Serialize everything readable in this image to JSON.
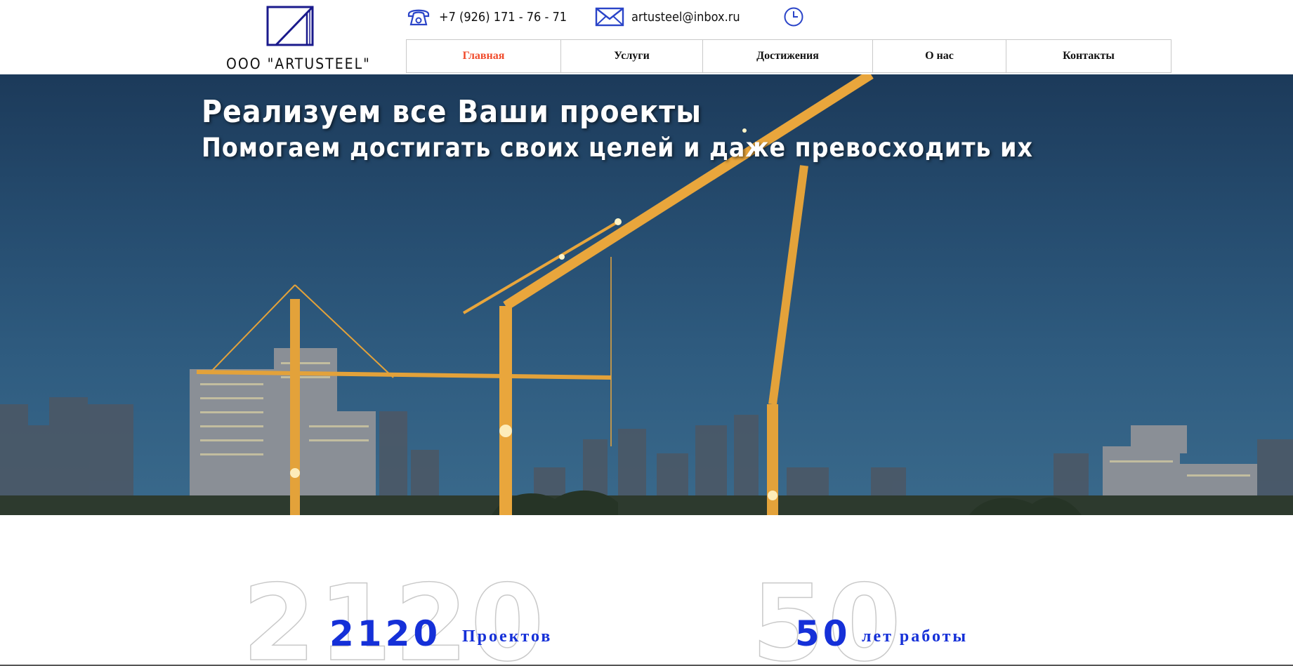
{
  "brand": {
    "name": "ООО \"ARTUSTEEL\"",
    "logo_icon": "logo-mark-icon",
    "color": "#1a1a8c"
  },
  "contacts": {
    "phone": {
      "icon": "phone-icon",
      "text": "+7 (926) 171 - 76 - 71"
    },
    "email": {
      "icon": "mail-icon",
      "text": "artusteel@inbox.ru"
    },
    "hours": {
      "icon": "clock-icon"
    },
    "icon_color": "#2a44c8"
  },
  "nav": {
    "items": [
      {
        "label": "Главная",
        "active": true
      },
      {
        "label": "Услуги",
        "active": false
      },
      {
        "label": "Достижения",
        "active": false
      },
      {
        "label": "О нас",
        "active": false
      },
      {
        "label": "Контакты",
        "active": false
      }
    ],
    "active_color": "#f04a2a"
  },
  "hero": {
    "title": "Реализуем все Ваши проекты",
    "subtitle": "Помогаем достигать своих целей и даже превосходить их",
    "image": "construction-cranes-night-city"
  },
  "stats": [
    {
      "value": "2120",
      "label": "Проектов"
    },
    {
      "value": "50",
      "label": "лет работы"
    }
  ],
  "accent_color": "#1530d8"
}
